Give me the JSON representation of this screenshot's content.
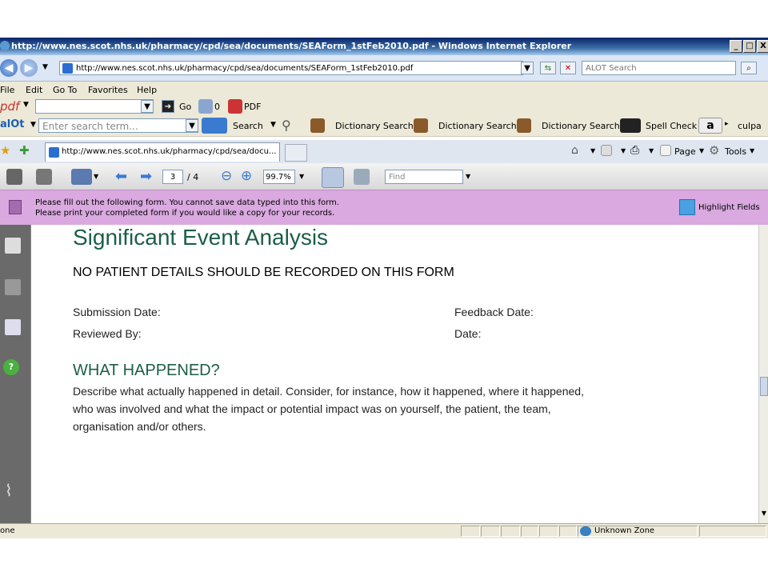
{
  "window": {
    "title": "http://www.nes.scot.nhs.uk/pharmacy/cpd/sea/documents/SEAForm_1stFeb2010.pdf - Windows Internet Explorer",
    "minimize": "_",
    "maximize": "□",
    "close": "X"
  },
  "address": {
    "url": "http://www.nes.scot.nhs.uk/pharmacy/cpd/sea/documents/SEAForm_1stFeb2010.pdf",
    "search_placeholder": "ALOT Search"
  },
  "menu": [
    "File",
    "Edit",
    "Go To",
    "Favorites",
    "Help"
  ],
  "pdf_toolbar": {
    "brand": "pdf",
    "go_label": "Go",
    "count": "0",
    "pdf_label": "PDF"
  },
  "alot_toolbar": {
    "brand": "alOt",
    "search_placeholder": "Enter search term...",
    "search_label": "Search",
    "dictionary_labels": [
      "Dictionary Search",
      "Dictionary Search",
      "Dictionary Search"
    ],
    "spell_check": "Spell Check",
    "amazon": "a",
    "culpa": "culpa"
  },
  "tabs": {
    "active_title": "http://www.nes.scot.nhs.uk/pharmacy/cpd/sea/docu...",
    "page_label": "Page",
    "tools_label": "Tools"
  },
  "reader": {
    "page_current": "3",
    "page_total": "/ 4",
    "zoom": "99.7%",
    "find_placeholder": "Find"
  },
  "form_notice": {
    "line1": "Please fill out the following form. You cannot save data typed into this form.",
    "line2": "Please print your completed form if you would like a copy for your records.",
    "highlight_label": "Highlight Fields"
  },
  "document": {
    "title": "Significant Event Analysis",
    "warning": "NO PATIENT DETAILS SHOULD BE RECORDED ON THIS FORM",
    "submission_date": "Submission Date:",
    "feedback_date": "Feedback Date:",
    "reviewed_by": "Reviewed By:",
    "date": "Date:",
    "section_heading": "WHAT HAPPENED?",
    "body_lines": [
      "Describe what actually happened in detail. Consider, for instance, how it happened, where it happened,",
      "who was involved and what the impact or potential impact was on yourself, the patient, the team,",
      "organisation and/or others."
    ]
  },
  "status": {
    "left_text": "one",
    "zone": "Unknown Zone"
  }
}
